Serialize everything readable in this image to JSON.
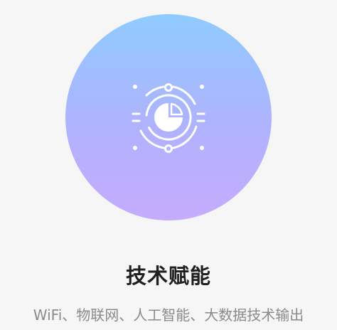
{
  "feature": {
    "title": "技术赋能",
    "description": "WiFi、物联网、人工智能、大数据技术输出",
    "icon": "orbit-gauge-icon",
    "colors": {
      "gradient_top": "#8fcbfe",
      "gradient_bottom": "#c6acfd",
      "icon_stroke": "#ffffff",
      "title_text": "#1f1f1f",
      "desc_text": "#8a8a8a",
      "background": "#f6f6f6"
    }
  }
}
